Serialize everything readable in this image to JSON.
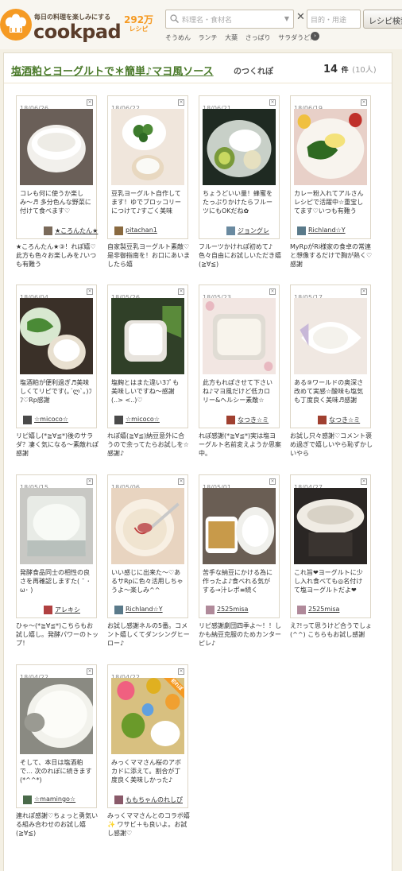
{
  "header": {
    "tagline": "毎日の料理を楽しみにする",
    "logo": "cookpad",
    "recipe_count": "292万",
    "recipe_unit": "レシピ",
    "search_placeholder": "料理名・食材名",
    "purpose_placeholder": "目的・用途",
    "search_button": "レシピ検索",
    "keywords": [
      "そうめん",
      "ランチ",
      "大葉",
      "さっぱり",
      "サラダうどん"
    ]
  },
  "page": {
    "title": "塩酒粕とヨーグルトで＊簡単♪マヨ風ソース",
    "title_suffix": "のつくれぽ",
    "count": "14",
    "count_unit": "件",
    "people": "(10人)"
  },
  "cards": [
    {
      "date": "18/06/26",
      "text": "コレも何に使うか楽しみ〜♬ 多分色んな野菜に付けて食べます♡",
      "author": "★ころんたん★",
      "reply": "★ころんたん★③！れぽ嬉♡此方も色々お楽しみを♪いつも有難う"
    },
    {
      "date": "18/06/22",
      "text": "豆乳ヨーグルト自作してます！ゆでブロッコリーにつけて♪すごく美味",
      "author": "pitachan1",
      "reply": "自家製豆乳ヨーグルト素敵♡是非御指南を！お口にあいましたら嬉"
    },
    {
      "date": "18/06/21",
      "text": "ちょうどいい量！蜂蜜をたっぷりかけたらフルーツにもOKだね✿",
      "author": "ジョングレ",
      "reply": "フルーツかけれぽ初めて♪色々自由にお試しいただき嬉(≧∀≦)"
    },
    {
      "date": "18/06/19",
      "text": "カレー粉入れてアルさんレシピで活躍中☆重宝してます♡いつも有難う",
      "author": "Richland☆Y",
      "reply": "MyRpがRi様家の食卓の常連と想像するだけで胸が熱く♡感謝"
    },
    {
      "date": "18/06/04",
      "text": "塩酒粕が便利過ぎ♬美味しくてリピです(｡´ლ`｡)ﾌﾌ♡Rp感謝",
      "author": "☆micoco☆",
      "reply": "リピ嬉し(*≧∀≦*)後のサラダ？凄く気になる〜素敵れぽ感謝"
    },
    {
      "date": "18/05/26",
      "text": "塩麹とはまた違い3ﾌﾟも美味しいですね〜感謝(..> <..)♡",
      "author": "☆micoco☆",
      "reply": "れぽ嬉(≧∀≦)納豆意外に合うので余ってたらお試しを☆感謝♪"
    },
    {
      "date": "18/05/23",
      "text": "此方もれぽさせて下さいね♪マヨ風だけど低カロリー&ヘルシー素敵☆",
      "author": "なつき☆ミ",
      "reply": "れぽ感謝(*≧∀≦*)実は塩ヨーグルト名前変えようか思案中。"
    },
    {
      "date": "18/05/17",
      "text": "ある⑨ワールドの奥深さ改めて実感☆酸味も塩気も丁度良く美味♬感謝",
      "author": "なつき☆ミ",
      "reply": "お試し只々感謝♡コメント褒め過ぎで嬉しいやら恥ずかしいやら"
    },
    {
      "date": "18/05/15",
      "text": "発酵食品同士の相性の良さを再確認しますた( ˘ ･ω･ )",
      "author": "アレキシ",
      "reply": "ひゃ〜(*≧∀≦*)こちらもお試し嬉し。発酵パワーのトップ！"
    },
    {
      "date": "18/05/06",
      "text": "いい感じに出来た〜♡あるサRpに色々活用しちゃうよ〜楽しみ^^",
      "author": "Richland☆Y",
      "reply": "お試し感謝ネルの5番。コメント嬉しくてダンシングヒーロー♪"
    },
    {
      "date": "18/05/01",
      "text": "苦手な納豆にかける為に作ったよ♪食べれる気がする→汁レポ≡続く",
      "author": "2525misa",
      "reply": "リピ感謝劇団四季よ〜！！しかも納豆克服のためカンターピレ♪"
    },
    {
      "date": "18/04/27",
      "text": "これ旨❤ヨーグルトに少し入れ食べても◎名付けて塩ヨーグルトだよ❤",
      "author": "2525misa",
      "reply": "え?!って思うけど合うでしょ(^^) こちらもお試し感謝"
    },
    {
      "date": "18/04/22",
      "text": "そして、本日は塩酒粕で… 次のれぽに続きます(*^^*)",
      "author": "☆mamingo☆",
      "reply": "連れぽ感謝♡ちょっと勇気いる組み合わせのお試し嬉(≧∀≦)"
    },
    {
      "date": "18/04/22",
      "text": "みっくママさん桜のアボカドに添えて。割合が丁度良く美味しかった♪",
      "author": "ももちゃんのれしぴ",
      "reply": "みっくママさんとのコラボ嬉✨ ワサビ＋も良いよ。お試し感謝♡",
      "badge": "初れぽ"
    }
  ]
}
